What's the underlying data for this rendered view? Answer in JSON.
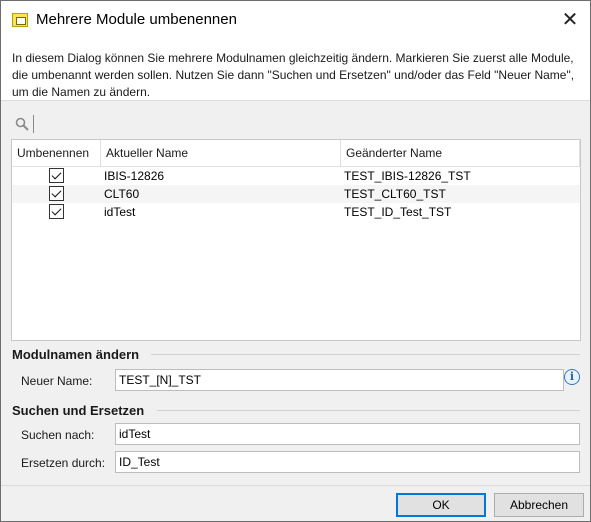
{
  "window": {
    "title": "Mehrere Module umbenennen",
    "close_glyph": "✕"
  },
  "intro_text": "In diesem Dialog können Sie mehrere Modulnamen gleichzeitig ändern. Markieren Sie zuerst alle Module, die umbenannt werden sollen. Nutzen Sie dann \"Suchen und Ersetzen\" und/oder das Feld \"Neuer Name\", um die Namen zu ändern.",
  "search": {
    "value": "",
    "icon": "search-icon"
  },
  "table": {
    "headers": [
      "Umbenennen",
      "Aktueller Name",
      "Geänderter Name"
    ],
    "rows": [
      {
        "rename": true,
        "current": "IBIS-12826",
        "changed": "TEST_IBIS-12826_TST"
      },
      {
        "rename": true,
        "current": "CLT60",
        "changed": "TEST_CLT60_TST"
      },
      {
        "rename": true,
        "current": "idTest",
        "changed": "TEST_ID_Test_TST"
      }
    ]
  },
  "rename_section": {
    "title": "Modulnamen ändern",
    "new_name_label": "Neuer Name:",
    "new_name_value": "TEST_[N]_TST",
    "info_glyph": "i"
  },
  "replace_section": {
    "title": "Suchen und Ersetzen",
    "search_label": "Suchen nach:",
    "search_value": "idTest",
    "replace_label": "Ersetzen durch:",
    "replace_value": "ID_Test"
  },
  "buttons": {
    "ok": "OK",
    "cancel": "Abbrechen"
  }
}
